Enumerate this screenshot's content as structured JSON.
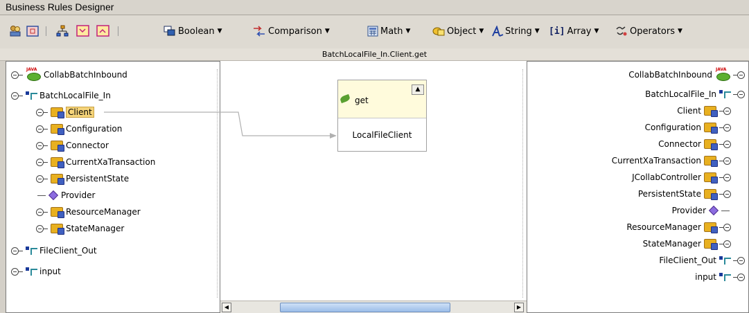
{
  "window": {
    "title": "Business Rules Designer"
  },
  "toolbar": {
    "boolean_label": "Boolean",
    "comparison_label": "Comparison",
    "math_label": "Math",
    "object_label": "Object",
    "string_label": "String",
    "array_label": "Array",
    "operators_label": "Operators"
  },
  "canvas": {
    "title": "BatchLocalFile_In.Client.get"
  },
  "left_tree": {
    "root_collab": "CollabBatchInbound",
    "batch_in": "BatchLocalFile_In",
    "children": [
      "Client",
      "Configuration",
      "Connector",
      "CurrentXaTransaction",
      "PersistentState",
      "Provider",
      "ResourceManager",
      "StateManager"
    ],
    "file_out": "FileClient_Out",
    "input": "input"
  },
  "method": {
    "name": "get",
    "param": "LocalFileClient"
  },
  "right_tree": {
    "root_collab": "CollabBatchInbound",
    "batch_in": "BatchLocalFile_In",
    "children": [
      "Client",
      "Configuration",
      "Connector",
      "CurrentXaTransaction",
      "JCollabController",
      "PersistentState",
      "Provider",
      "ResourceManager",
      "StateManager"
    ],
    "file_out": "FileClient_Out",
    "input": "input"
  },
  "colors": {
    "selection": "#f5d47a",
    "method_header": "#fffbdc",
    "scroll_thumb": "#9bbde8"
  }
}
